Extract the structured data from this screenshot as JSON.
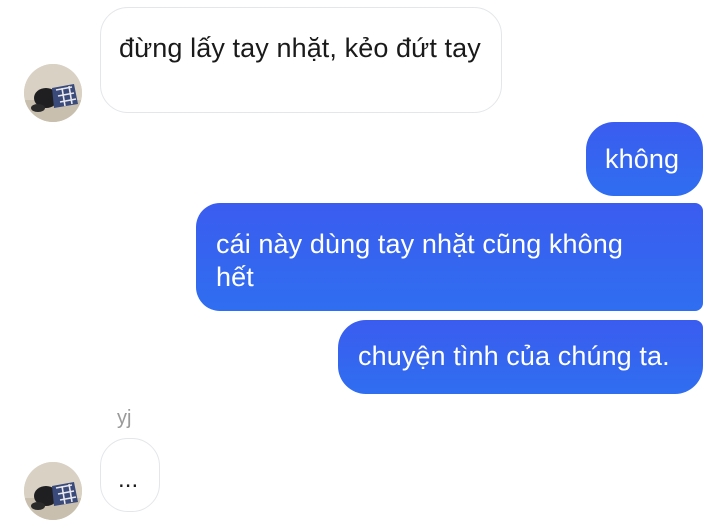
{
  "messages": [
    {
      "direction": "incoming",
      "text": "đừng lấy tay nhặt, kẻo đứt tay"
    },
    {
      "direction": "outgoing",
      "text": "không"
    },
    {
      "direction": "outgoing",
      "text": "cái này dùng tay nhặt cũng không hết"
    },
    {
      "direction": "outgoing",
      "text": "chuyện tình của chúng ta."
    },
    {
      "direction": "incoming",
      "sender": "yj",
      "text": "..."
    }
  ],
  "colors": {
    "outgoing_bubble": "#3b5cf0",
    "incoming_bubble": "#ffffff",
    "incoming_border": "#e4e6ea"
  },
  "icons": {
    "avatar": "user-avatar-photo"
  }
}
